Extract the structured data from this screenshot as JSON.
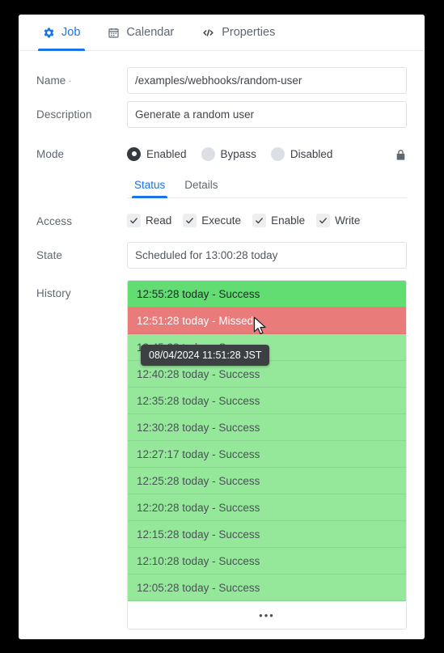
{
  "window": {
    "background_color": "#000000",
    "card_color": "#ffffff"
  },
  "tabs": [
    {
      "id": "job",
      "label": "Job",
      "icon": "gear-icon",
      "active": true
    },
    {
      "id": "calendar",
      "label": "Calendar",
      "icon": "calendar-icon",
      "active": false
    },
    {
      "id": "properties",
      "label": "Properties",
      "icon": "code-icon",
      "active": false
    }
  ],
  "form": {
    "name": {
      "label": "Name",
      "required_marker": "·",
      "value": "/examples/webhooks/random-user",
      "placeholder": "Name"
    },
    "description": {
      "label": "Description",
      "value": "Generate a random user",
      "placeholder": "Description"
    },
    "mode": {
      "label": "Mode",
      "options": [
        {
          "label": "Enabled",
          "selected": true
        },
        {
          "label": "Bypass",
          "selected": false
        },
        {
          "label": "Disabled",
          "selected": false
        }
      ],
      "lock_icon": "lock-icon"
    },
    "access": {
      "label": "Access",
      "options": [
        {
          "label": "Read",
          "checked": true
        },
        {
          "label": "Execute",
          "checked": true
        },
        {
          "label": "Enable",
          "checked": true
        },
        {
          "label": "Write",
          "checked": true
        }
      ]
    },
    "state": {
      "label": "State",
      "value": "Scheduled for 13:00:28 today"
    },
    "history": {
      "label": "History",
      "more_label": "•••",
      "entries": [
        {
          "text": "12:55:28 today - Success",
          "status": "success",
          "hover": true
        },
        {
          "text": "12:51:28 today - Missed",
          "status": "missed",
          "hover": false
        },
        {
          "text": "12:45:28 today - Success",
          "status": "success",
          "hover": false
        },
        {
          "text": "12:40:28 today - Success",
          "status": "success",
          "hover": false
        },
        {
          "text": "12:35:28 today - Success",
          "status": "success",
          "hover": false
        },
        {
          "text": "12:30:28 today - Success",
          "status": "success",
          "hover": false
        },
        {
          "text": "12:27:17 today - Success",
          "status": "success",
          "hover": false
        },
        {
          "text": "12:25:28 today - Success",
          "status": "success",
          "hover": false
        },
        {
          "text": "12:20:28 today - Success",
          "status": "success",
          "hover": false
        },
        {
          "text": "12:15:28 today - Success",
          "status": "success",
          "hover": false
        },
        {
          "text": "12:10:28 today - Success",
          "status": "success",
          "hover": false
        },
        {
          "text": "12:05:28 today - Success",
          "status": "success",
          "hover": false
        }
      ]
    }
  },
  "subtabs": [
    {
      "id": "status",
      "label": "Status",
      "active": true
    },
    {
      "id": "details",
      "label": "Details",
      "active": false
    }
  ],
  "tooltip": {
    "text": "08/04/2024 11:51:28 JST"
  },
  "colors": {
    "accent": "#1a73e8",
    "success": "#95e89a",
    "success_hover": "#62dd72",
    "missed": "#ea7b7b",
    "tooltip_bg": "#3c4043",
    "label_text": "#5f6771"
  }
}
